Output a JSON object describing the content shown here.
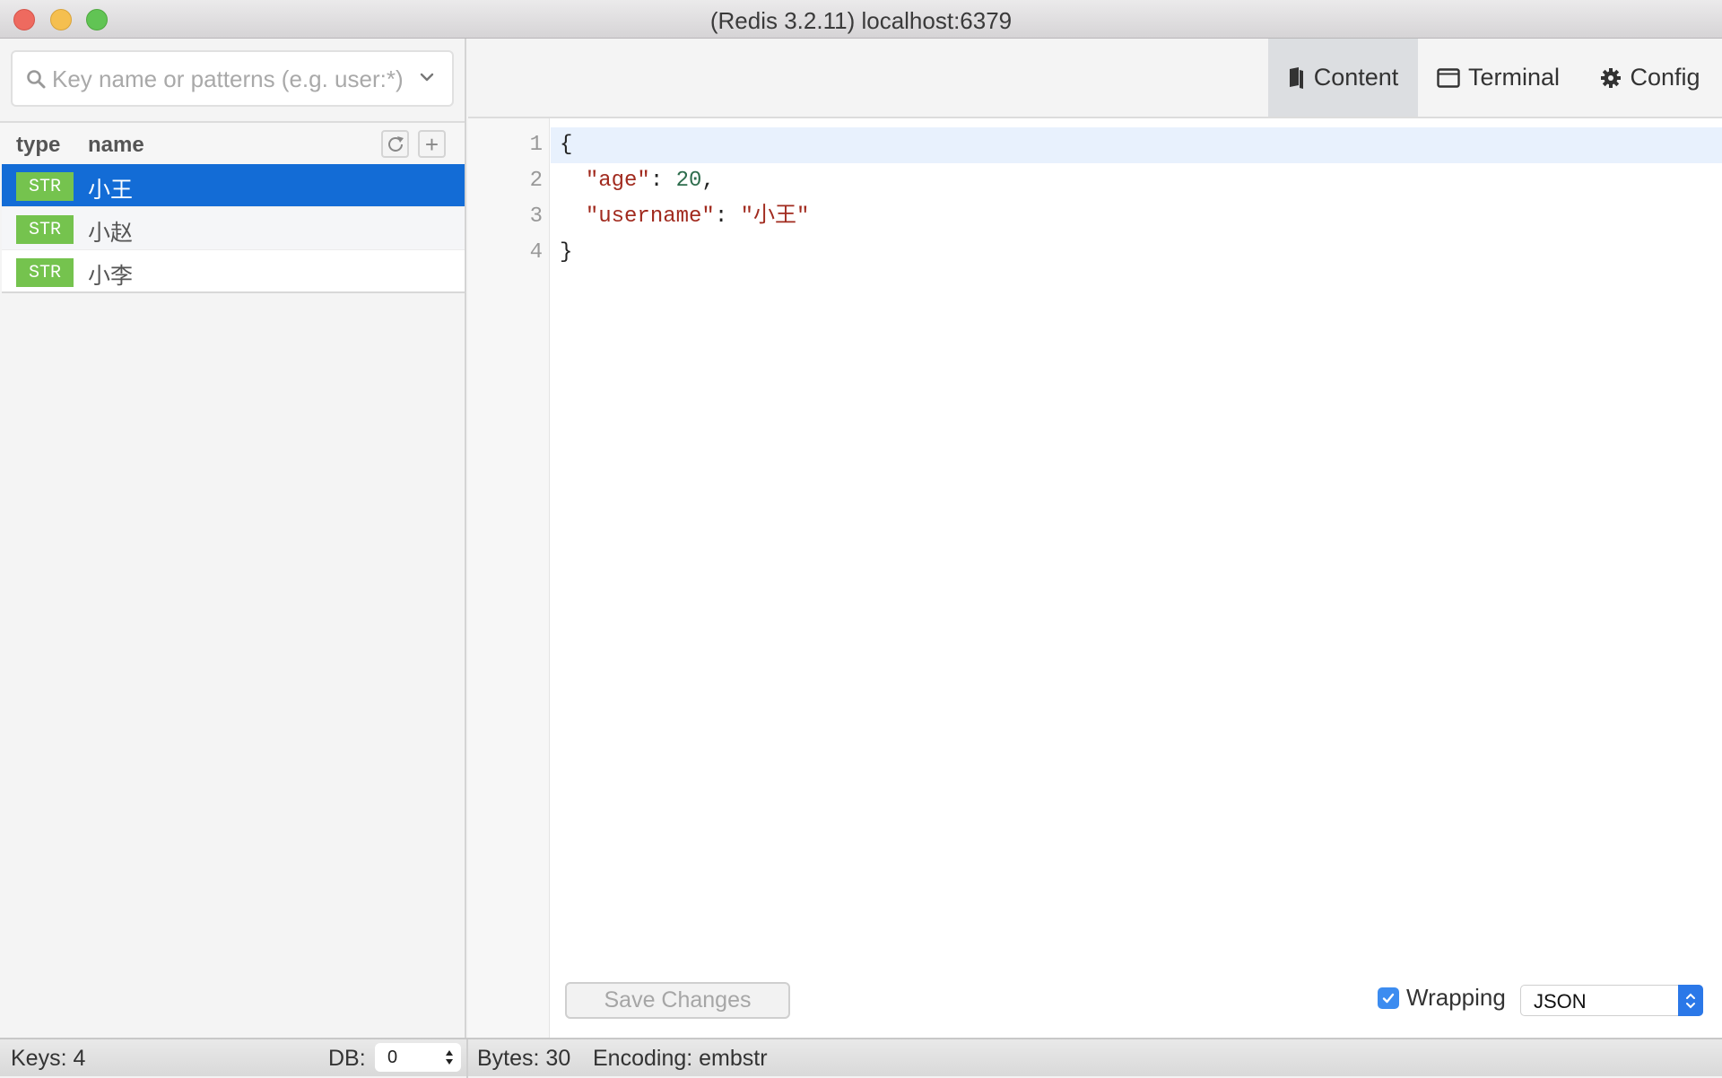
{
  "window": {
    "title": "(Redis 3.2.11) localhost:6379"
  },
  "sidebar": {
    "search": {
      "placeholder": "Key name or patterns (e.g. user:*)",
      "value": ""
    },
    "header": {
      "type_label": "type",
      "name_label": "name",
      "refresh_icon": "refresh-icon",
      "add_icon": "plus-icon",
      "add_label": "+"
    },
    "keys": [
      {
        "type": "STR",
        "name": "小王",
        "selected": true
      },
      {
        "type": "STR",
        "name": "小赵",
        "selected": false
      },
      {
        "type": "STR",
        "name": "小李",
        "selected": false
      }
    ],
    "colors": {
      "selected_row": "#136cd6",
      "str_badge": "#75c34e"
    }
  },
  "tabs": [
    {
      "label": "Content",
      "icon": "book-icon",
      "active": true
    },
    {
      "label": "Terminal",
      "icon": "window-icon",
      "active": false
    },
    {
      "label": "Config",
      "icon": "gear-icon",
      "active": false
    }
  ],
  "editor": {
    "lines": [
      {
        "number": "1",
        "brace": "{"
      },
      {
        "number": "2",
        "key": "\"age\"",
        "sep": ": ",
        "value": "20",
        "trail": ","
      },
      {
        "number": "3",
        "key": "\"username\"",
        "sep": ": ",
        "value": "\"小王\"",
        "trail": ""
      },
      {
        "number": "4",
        "brace": "}"
      }
    ],
    "save_label": "Save Changes",
    "wrapping_label": "Wrapping",
    "wrapping_checked": true,
    "format_selected": "JSON"
  },
  "statusbar": {
    "keys": "Keys: 4",
    "db_label": "DB:",
    "db_value": "0",
    "bytes": "Bytes: 30",
    "encoding": "Encoding: embstr"
  }
}
